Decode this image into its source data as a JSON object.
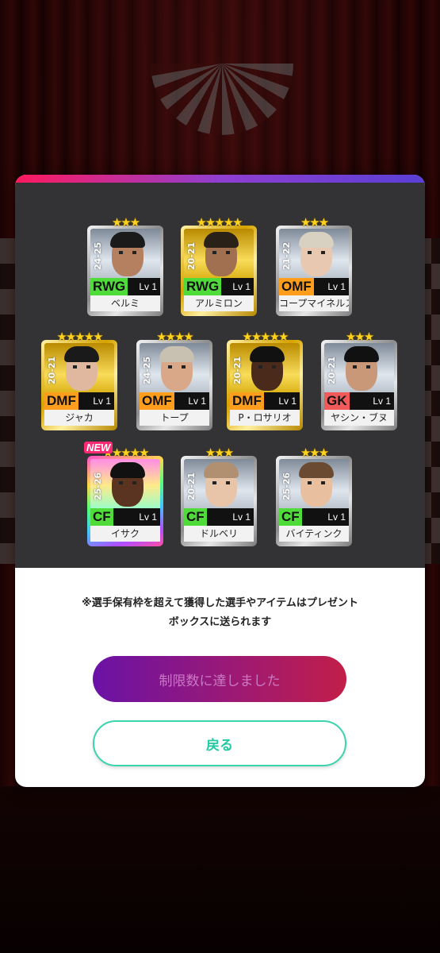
{
  "cards": [
    {
      "season": "24-25",
      "position": "RWG",
      "pos_class": "fw",
      "level": "Lv 1",
      "name": "ベルミ",
      "frame": "silver",
      "stars": "★★★",
      "is_new": false,
      "skin": "#b58060",
      "hair_color": "#1a1a1a"
    },
    {
      "season": "20-21",
      "position": "RWG",
      "pos_class": "fw",
      "level": "Lv 1",
      "name": "アルミロン",
      "frame": "gold",
      "stars": "★★★★★",
      "is_new": false,
      "skin": "#a07050",
      "hair_color": "#2a2218"
    },
    {
      "season": "21-22",
      "position": "OMF",
      "pos_class": "mf",
      "level": "Lv 1",
      "name": "コープマイネルス",
      "frame": "silver",
      "stars": "★★★",
      "is_new": false,
      "skin": "#e8c8b0",
      "hair_color": "#d8d0c0"
    },
    {
      "season": "20-21",
      "position": "DMF",
      "pos_class": "mf",
      "level": "Lv 1",
      "name": "ジャカ",
      "frame": "gold",
      "stars": "★★★★★",
      "is_new": false,
      "skin": "#e0b8a0",
      "hair_color": "#1a1a1a"
    },
    {
      "season": "24-25",
      "position": "OMF",
      "pos_class": "mf",
      "level": "Lv 1",
      "name": "トープ",
      "frame": "silver",
      "stars": "★★★★",
      "is_new": false,
      "skin": "#d8a888",
      "hair_color": "#c8c0b0"
    },
    {
      "season": "20-21",
      "position": "DMF",
      "pos_class": "mf",
      "level": "Lv 1",
      "name": "P・ロサリオ",
      "frame": "gold",
      "stars": "★★★★★",
      "is_new": false,
      "skin": "#4a2a1a",
      "hair_color": "#111111"
    },
    {
      "season": "20-21",
      "position": "GK",
      "pos_class": "gk",
      "level": "Lv 1",
      "name": "ヤシン・ブヌ",
      "frame": "silver",
      "stars": "★★★",
      "is_new": false,
      "skin": "#c89878",
      "hair_color": "#111111"
    },
    {
      "season": "25-26",
      "position": "CF",
      "pos_class": "fw",
      "level": "Lv 1",
      "name": "イサク",
      "frame": "rainbow",
      "stars": "★★★★★",
      "is_new": true,
      "new_label": "NEW",
      "skin": "#5a3420",
      "hair_color": "#111111"
    },
    {
      "season": "20-21",
      "position": "CF",
      "pos_class": "fw",
      "level": "Lv 1",
      "name": "ドルベリ",
      "frame": "silver",
      "stars": "★★★",
      "is_new": false,
      "skin": "#e8c4a8",
      "hair_color": "#b09070"
    },
    {
      "season": "25-26",
      "position": "CF",
      "pos_class": "fw",
      "level": "Lv 1",
      "name": "バイティンク",
      "frame": "silver",
      "stars": "★★★",
      "is_new": false,
      "skin": "#e8c0a0",
      "hair_color": "#6a4a30"
    }
  ],
  "notice": "※選手保有枠を超えて獲得した選手やアイテムはプレゼントボックスに送られます",
  "buttons": {
    "limit_label": "制限数に達しました",
    "back_label": "戻る"
  },
  "colors": {
    "modal_gradient": [
      "#ff1a5e",
      "#8f3fd0",
      "#5a3fd6"
    ],
    "back_accent": "#22c9a1"
  }
}
